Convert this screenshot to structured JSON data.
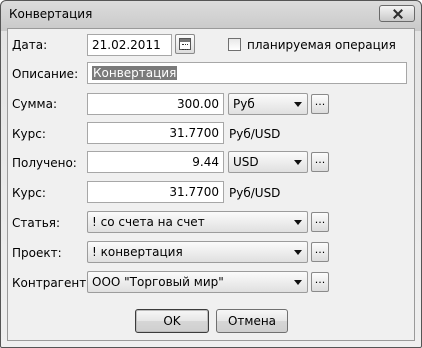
{
  "window": {
    "title": "Конвертация"
  },
  "date": {
    "label": "Дата:",
    "value": "21.02.2011"
  },
  "planned": {
    "label": "планируемая операция",
    "checked": false
  },
  "description": {
    "label": "Описание:",
    "value": "Конвертация"
  },
  "amount": {
    "label": "Сумма:",
    "value": "300.00",
    "currency": "Руб"
  },
  "rate1": {
    "label": "Курс:",
    "value": "31.7700",
    "unit": "Руб/USD"
  },
  "received": {
    "label": "Получено:",
    "value": "9.44",
    "currency": "USD"
  },
  "rate2": {
    "label": "Курс:",
    "value": "31.7700",
    "unit": "Руб/USD"
  },
  "article": {
    "label": "Статья:",
    "value": "! со счета на счет"
  },
  "project": {
    "label": "Проект:",
    "value": "! конвертация"
  },
  "counterparty": {
    "label": "Контрагент:",
    "value": "ООО \"Торговый мир\""
  },
  "browse_label": "...",
  "buttons": {
    "ok": "OK",
    "cancel": "Отмена"
  }
}
